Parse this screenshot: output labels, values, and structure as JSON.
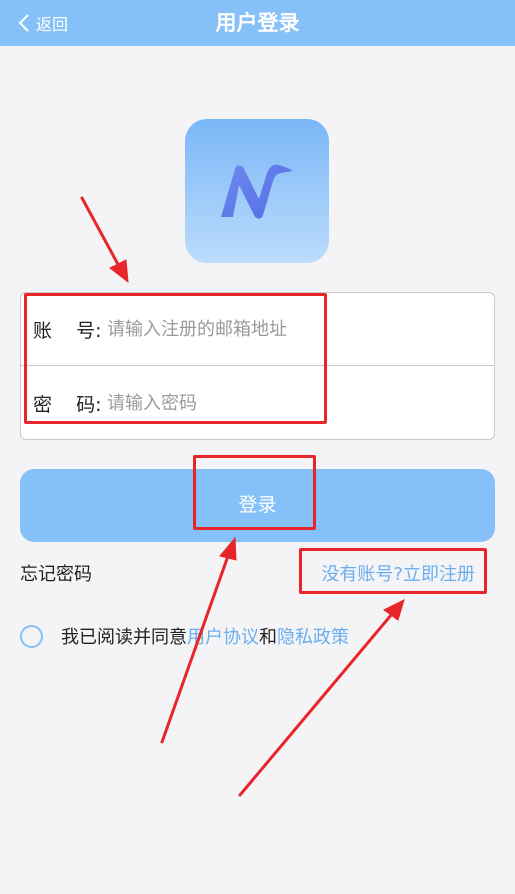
{
  "header": {
    "back_label": "返回",
    "title": "用户登录"
  },
  "logo": {
    "icon": "app-logo-n"
  },
  "form": {
    "account_label": "账    号:",
    "account_placeholder": "请输入注册的邮箱地址",
    "password_label": "密    码:",
    "password_placeholder": "请输入密码"
  },
  "login_button": "登录",
  "forgot_password": "忘记密码",
  "register_link": "没有账号?立即注册",
  "agreement": {
    "prefix": "我已阅读并同意",
    "user_agreement": "用户协议",
    "conjunction": "和",
    "privacy_policy": "隐私政策"
  },
  "colors": {
    "primary": "#86c0f8",
    "link": "#6aaef0",
    "annotation": "#e8262a"
  }
}
